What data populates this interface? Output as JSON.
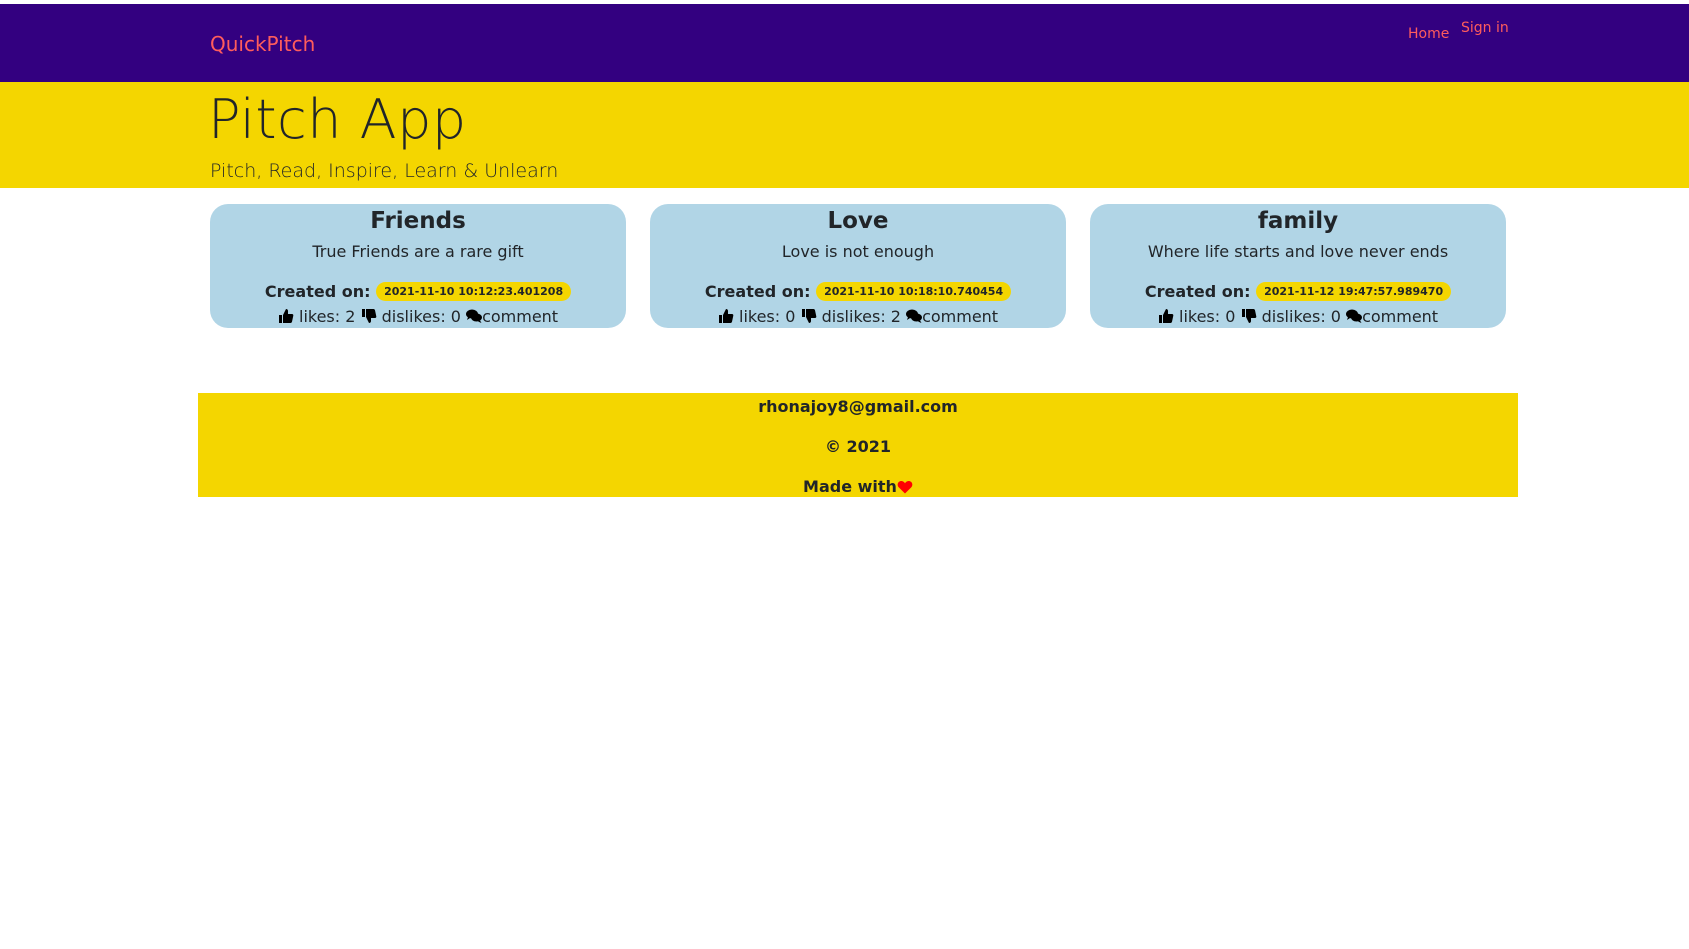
{
  "nav": {
    "brand": "QuickPitch",
    "home": "Home",
    "signin": "Sign in"
  },
  "hero": {
    "title": "Pitch App",
    "subtitle": "Pitch, Read, Inspire, Learn & Unlearn"
  },
  "pitches": [
    {
      "category": "Friends",
      "description": "True Friends are a rare gift",
      "created_label": "Created on:",
      "created": "2021-11-10 10:12:23.401208",
      "likes_text": "likes: 2",
      "dislikes_text": "dislikes: 0",
      "comment_text": "comment"
    },
    {
      "category": "Love",
      "description": "Love is not enough",
      "created_label": "Created on:",
      "created": "2021-11-10 10:18:10.740454",
      "likes_text": "likes: 0",
      "dislikes_text": "dislikes: 2",
      "comment_text": "comment"
    },
    {
      "category": "family",
      "description": "Where life starts and love never ends",
      "created_label": "Created on:",
      "created": "2021-11-12 19:47:57.989470",
      "likes_text": "likes: 0",
      "dislikes_text": "dislikes: 0",
      "comment_text": "comment"
    }
  ],
  "footer": {
    "email": "rhonajoy8@gmail.com",
    "copyright": "© 2021",
    "made_with": "Made with"
  },
  "icons": {
    "like": "thumbs-up-icon",
    "dislike": "thumbs-down-icon",
    "comment": "comments-icon",
    "heart": "heart-icon"
  },
  "colors": {
    "navbar": "#330080",
    "accent_link": "#ff5c5c",
    "yellow": "#f4d600",
    "card": "#b1d5e6",
    "heart": "#ff0000"
  }
}
